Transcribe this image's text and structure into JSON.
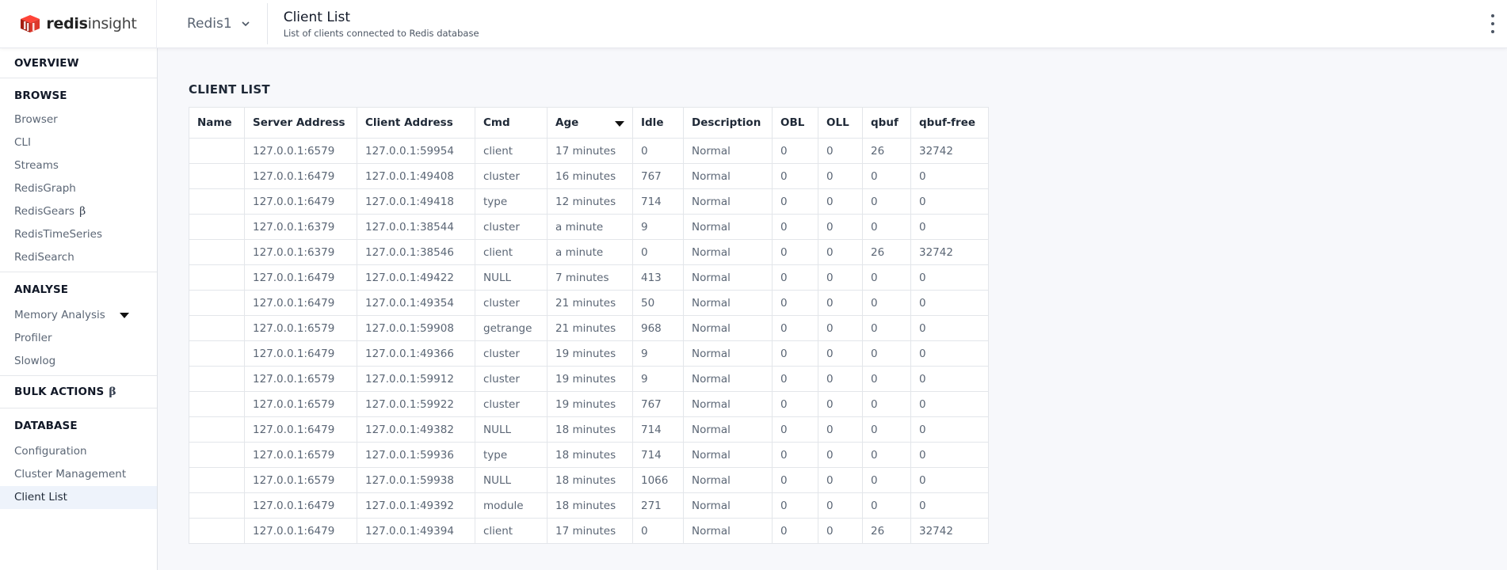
{
  "header": {
    "logo_bold": "redis",
    "logo_light": "insight",
    "database_name": "Redis1",
    "page_title": "Client List",
    "page_subtitle": "List of clients connected to Redis database",
    "icons": {
      "logo": "redis-logo-icon",
      "chevron": "chevron-down-icon",
      "menu": "kebab-menu-icon"
    }
  },
  "sidebar": {
    "overview": "OVERVIEW",
    "browse": {
      "title": "BROWSE",
      "items": [
        "Browser",
        "CLI",
        "Streams",
        "RedisGraph",
        "RedisGears",
        "RedisTimeSeries",
        "RediSearch"
      ]
    },
    "analyse": {
      "title": "ANALYSE",
      "items": [
        "Memory Analysis",
        "Profiler",
        "Slowlog"
      ]
    },
    "bulk_actions": "BULK ACTIONS",
    "beta_symbol": "β",
    "database": {
      "title": "DATABASE",
      "items": [
        "Configuration",
        "Cluster Management",
        "Client List"
      ],
      "active": "Client List"
    }
  },
  "main": {
    "section_title": "CLIENT LIST",
    "columns": [
      "Name",
      "Server Address",
      "Client Address",
      "Cmd",
      "Age",
      "Idle",
      "Description",
      "OBL",
      "OLL",
      "qbuf",
      "qbuf-free"
    ],
    "sorted_column": "Age",
    "rows": [
      [
        "",
        "127.0.0.1:6579",
        "127.0.0.1:59954",
        "client",
        "17 minutes",
        "0",
        "Normal",
        "0",
        "0",
        "26",
        "32742"
      ],
      [
        "",
        "127.0.0.1:6479",
        "127.0.0.1:49408",
        "cluster",
        "16 minutes",
        "767",
        "Normal",
        "0",
        "0",
        "0",
        "0"
      ],
      [
        "",
        "127.0.0.1:6479",
        "127.0.0.1:49418",
        "type",
        "12 minutes",
        "714",
        "Normal",
        "0",
        "0",
        "0",
        "0"
      ],
      [
        "",
        "127.0.0.1:6379",
        "127.0.0.1:38544",
        "cluster",
        "a minute",
        "9",
        "Normal",
        "0",
        "0",
        "0",
        "0"
      ],
      [
        "",
        "127.0.0.1:6379",
        "127.0.0.1:38546",
        "client",
        "a minute",
        "0",
        "Normal",
        "0",
        "0",
        "26",
        "32742"
      ],
      [
        "",
        "127.0.0.1:6479",
        "127.0.0.1:49422",
        "NULL",
        "7 minutes",
        "413",
        "Normal",
        "0",
        "0",
        "0",
        "0"
      ],
      [
        "",
        "127.0.0.1:6479",
        "127.0.0.1:49354",
        "cluster",
        "21 minutes",
        "50",
        "Normal",
        "0",
        "0",
        "0",
        "0"
      ],
      [
        "",
        "127.0.0.1:6579",
        "127.0.0.1:59908",
        "getrange",
        "21 minutes",
        "968",
        "Normal",
        "0",
        "0",
        "0",
        "0"
      ],
      [
        "",
        "127.0.0.1:6479",
        "127.0.0.1:49366",
        "cluster",
        "19 minutes",
        "9",
        "Normal",
        "0",
        "0",
        "0",
        "0"
      ],
      [
        "",
        "127.0.0.1:6579",
        "127.0.0.1:59912",
        "cluster",
        "19 minutes",
        "9",
        "Normal",
        "0",
        "0",
        "0",
        "0"
      ],
      [
        "",
        "127.0.0.1:6579",
        "127.0.0.1:59922",
        "cluster",
        "19 minutes",
        "767",
        "Normal",
        "0",
        "0",
        "0",
        "0"
      ],
      [
        "",
        "127.0.0.1:6479",
        "127.0.0.1:49382",
        "NULL",
        "18 minutes",
        "714",
        "Normal",
        "0",
        "0",
        "0",
        "0"
      ],
      [
        "",
        "127.0.0.1:6579",
        "127.0.0.1:59936",
        "type",
        "18 minutes",
        "714",
        "Normal",
        "0",
        "0",
        "0",
        "0"
      ],
      [
        "",
        "127.0.0.1:6579",
        "127.0.0.1:59938",
        "NULL",
        "18 minutes",
        "1066",
        "Normal",
        "0",
        "0",
        "0",
        "0"
      ],
      [
        "",
        "127.0.0.1:6479",
        "127.0.0.1:49392",
        "module",
        "18 minutes",
        "271",
        "Normal",
        "0",
        "0",
        "0",
        "0"
      ],
      [
        "",
        "127.0.0.1:6479",
        "127.0.0.1:49394",
        "client",
        "17 minutes",
        "0",
        "Normal",
        "0",
        "0",
        "26",
        "32742"
      ]
    ]
  },
  "colors": {
    "brand_red": "#dc382c",
    "active_bg": "#eef3fb",
    "border": "#e3e6ea",
    "text_muted": "#5b6675"
  }
}
